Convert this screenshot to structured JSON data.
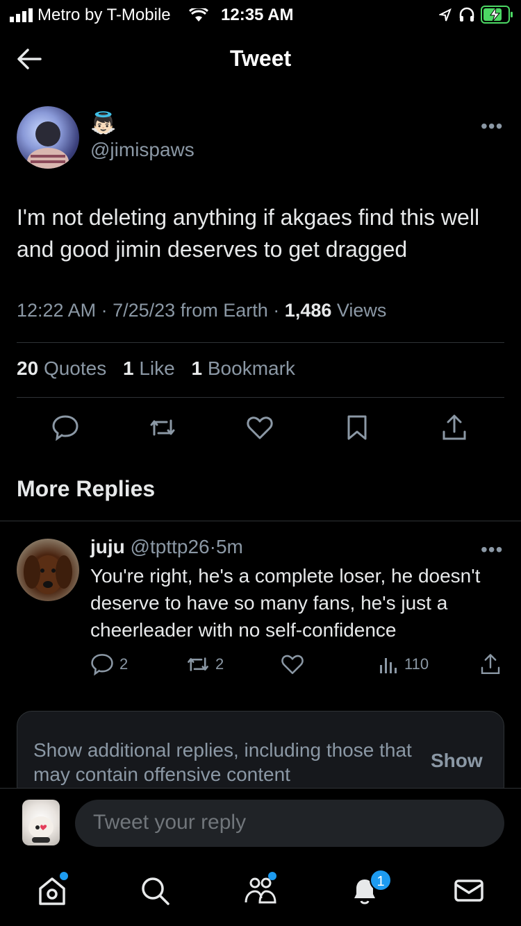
{
  "status_bar": {
    "carrier": "Metro by T-Mobile",
    "time": "12:35 AM"
  },
  "header": {
    "title": "Tweet",
    "back_icon": "arrow-left-icon"
  },
  "tweet": {
    "display_name_emoji": "👼🏻",
    "handle": "@jimispaws",
    "text": "I'm not deleting anything if akgaes find this well and good jimin deserves to get dragged",
    "time": "12:22 AM",
    "date": "7/25/23",
    "source": "from Earth",
    "views_count": "1,486",
    "views_label": "Views",
    "sep": "·",
    "stats": {
      "quotes_count": "20",
      "quotes_label": "Quotes",
      "likes_count": "1",
      "likes_label": "Like",
      "bookmarks_count": "1",
      "bookmarks_label": "Bookmark"
    },
    "more": "•••"
  },
  "section": {
    "more_replies": "More Replies"
  },
  "reply": {
    "name": "juju",
    "handle": "@tpttp26",
    "sep": "·",
    "age": "5m",
    "text": "You're right, he's a complete loser, he doesn't deserve to have so many fans, he's just a cheerleader with no self-confidence",
    "replies": "2",
    "retweets": "2",
    "views": "110",
    "more": "•••"
  },
  "banner": {
    "text": "Show additional replies, including those that may contain offensive content",
    "show_label": "Show"
  },
  "composer": {
    "placeholder": "Tweet your reply"
  },
  "tabbar": {
    "notifications_badge": "1"
  },
  "colors": {
    "accent": "#1d9bf0",
    "muted": "#8b98a5",
    "text": "#e7e9ea",
    "divider": "#2f3336"
  }
}
